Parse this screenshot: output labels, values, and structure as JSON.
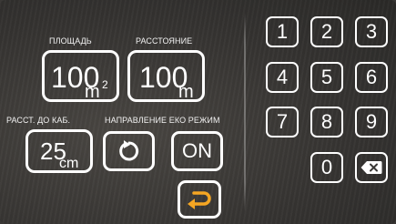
{
  "labels": {
    "area": "ПЛОЩАДЬ",
    "distance": "РАССТОЯНИЕ",
    "cable_distance": "РАССТ. ДО КАБ.",
    "direction_eco": "НАПРАВЛЕНИЕ ЕКО РЕЖИМ"
  },
  "area": {
    "value": "100",
    "unit": "m",
    "unit_sup": "2"
  },
  "distance": {
    "value": "100",
    "unit": "m"
  },
  "cable_distance": {
    "value": "25",
    "unit": "cm"
  },
  "eco_mode": {
    "label": "ON"
  },
  "keypad": {
    "keys": [
      "1",
      "2",
      "3",
      "4",
      "5",
      "6",
      "7",
      "8",
      "9",
      "0"
    ]
  },
  "icons": {
    "direction": "rotate-icon",
    "back": "return-arrow-icon",
    "backspace": "backspace-icon"
  },
  "colors": {
    "accent": "#f5a623",
    "outline": "#ffffff"
  }
}
